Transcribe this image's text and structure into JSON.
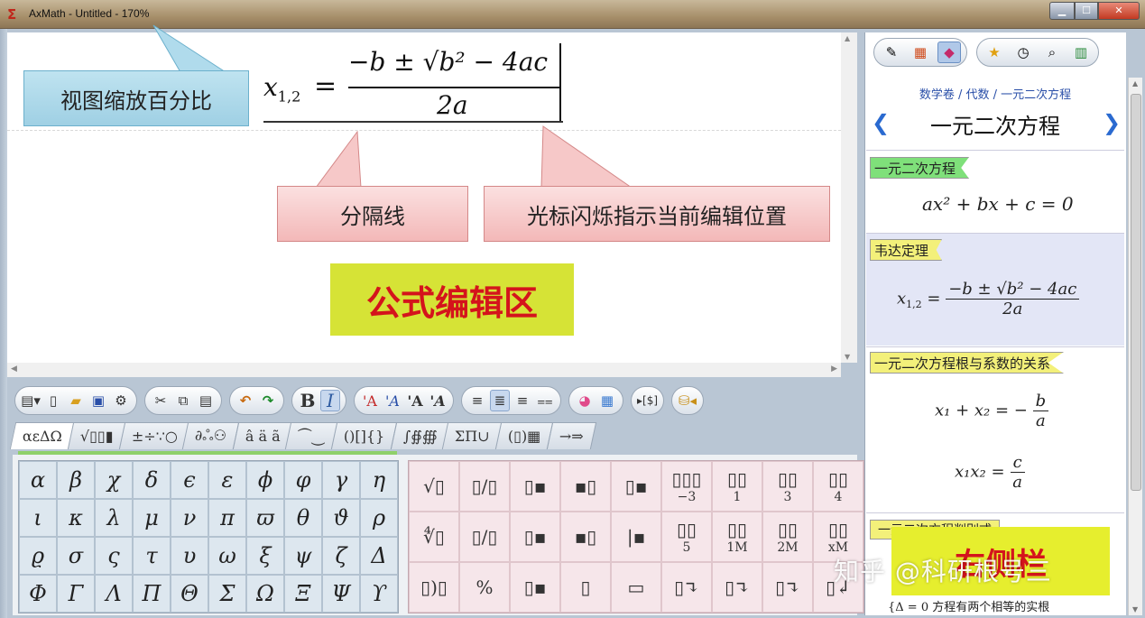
{
  "window": {
    "title": "AxMath - Untitled - 170%",
    "icon": "sigma-icon",
    "buttons": [
      "minimize",
      "maximize",
      "close"
    ]
  },
  "editor": {
    "formula": {
      "lhs": "x",
      "lhs_sub": "1,2",
      "eq": "=",
      "numerator": "−b ± √b² − 4ac",
      "denominator": "2a"
    },
    "callouts": {
      "zoom": "视图缩放百分比",
      "separator": "分隔线",
      "cursor": "光标闪烁指示当前编辑位置"
    },
    "area_label": "公式编辑区"
  },
  "toolbar": {
    "groups": [
      [
        "new-menu",
        "new-doc",
        "open-folder",
        "save",
        "settings"
      ],
      [
        "cut",
        "copy",
        "paste"
      ],
      [
        "undo",
        "redo"
      ],
      [
        "bold",
        "italic"
      ],
      [
        "font-A1",
        "font-A2",
        "font-A3",
        "font-A4"
      ],
      [
        "align-left",
        "align-center",
        "align-right",
        "align-eq"
      ],
      [
        "color",
        "grid"
      ],
      [
        "play-tex"
      ],
      [
        "export"
      ]
    ],
    "bold_label": "B",
    "italic_label": "I",
    "font_labels": [
      "'A",
      "'A",
      "'A",
      "'A"
    ]
  },
  "tabs": [
    "αεΔΩ",
    "√▯▯▮",
    "±÷∵○",
    "∂ஃ⚇",
    "â ä ã",
    "⏜⏝",
    "()[]{}",
    "∫∯∰",
    "ΣΠ∪",
    "(▯)▦",
    "→⇒"
  ],
  "greek": [
    [
      "α",
      "β",
      "χ",
      "δ",
      "ϵ",
      "ε",
      "ϕ",
      "φ",
      "γ",
      "η"
    ],
    [
      "ι",
      "κ",
      "λ",
      "μ",
      "ν",
      "π",
      "ϖ",
      "θ",
      "ϑ",
      "ρ"
    ],
    [
      "ϱ",
      "σ",
      "ς",
      "τ",
      "υ",
      "ω",
      "ξ",
      "ψ",
      "ζ",
      "Δ"
    ],
    [
      "Φ",
      "Γ",
      "Λ",
      "Π",
      "Θ",
      "Σ",
      "Ω",
      "Ξ",
      "Ψ",
      "ϒ"
    ]
  ],
  "templates": [
    [
      {
        "s": "√▯"
      },
      {
        "s": "▯/▯"
      },
      {
        "s": "▯▪"
      },
      {
        "s": "▪▯"
      },
      {
        "s": "▯▪"
      },
      {
        "s": "▯▯▯",
        "sub": "−3"
      },
      {
        "s": "▯▯",
        "sub": "1"
      },
      {
        "s": "▯▯",
        "sub": "3"
      },
      {
        "s": "▯▯",
        "sub": "4"
      }
    ],
    [
      {
        "s": "∜▯"
      },
      {
        "s": "▯/▯"
      },
      {
        "s": "▯▪"
      },
      {
        "s": "▪▯"
      },
      {
        "s": "|▪"
      },
      {
        "s": "▯▯",
        "sub": "5"
      },
      {
        "s": "▯▯",
        "sub": "1M"
      },
      {
        "s": "▯▯",
        "sub": "2M"
      },
      {
        "s": "▯▯",
        "sub": "xM"
      }
    ],
    [
      {
        "s": "▯)▯"
      },
      {
        "s": "%"
      },
      {
        "s": "▯▪"
      },
      {
        "s": "▯"
      },
      {
        "s": "▭"
      },
      {
        "s": "▯↴"
      },
      {
        "s": "▯↴"
      },
      {
        "s": "▯↴"
      },
      {
        "s": "▯↲"
      }
    ]
  ],
  "right_panel": {
    "toolbar_icons": [
      "brush-icon",
      "palette-icon",
      "diamond-icon",
      "star-icon",
      "clock-icon",
      "search-icon",
      "books-icon"
    ],
    "breadcrumb": "数学卷 / 代数 / 一元二次方程",
    "heading": "一元二次方程",
    "sections": [
      {
        "tag": "一元二次方程",
        "formula": "ax² + bx + c = 0"
      },
      {
        "tag": "韦达定理",
        "formula_lhs": "x",
        "formula_sub": "1,2",
        "numerator": "−b ± √b² − 4ac",
        "denominator": "2a"
      },
      {
        "tag": "一元二次方程根与系数的关系",
        "f1_lhs": "x₁ + x₂ = −",
        "f1_num": "b",
        "f1_den": "a",
        "f2_lhs": "x₁x₂ =",
        "f2_num": "c",
        "f2_den": "a"
      },
      {
        "tag": "一元二次方程判别式"
      }
    ],
    "bottom_note": "{Δ = 0  方程有两个相等的实根",
    "area_label": "右侧栏"
  },
  "watermark": "知乎 @科研根号三"
}
